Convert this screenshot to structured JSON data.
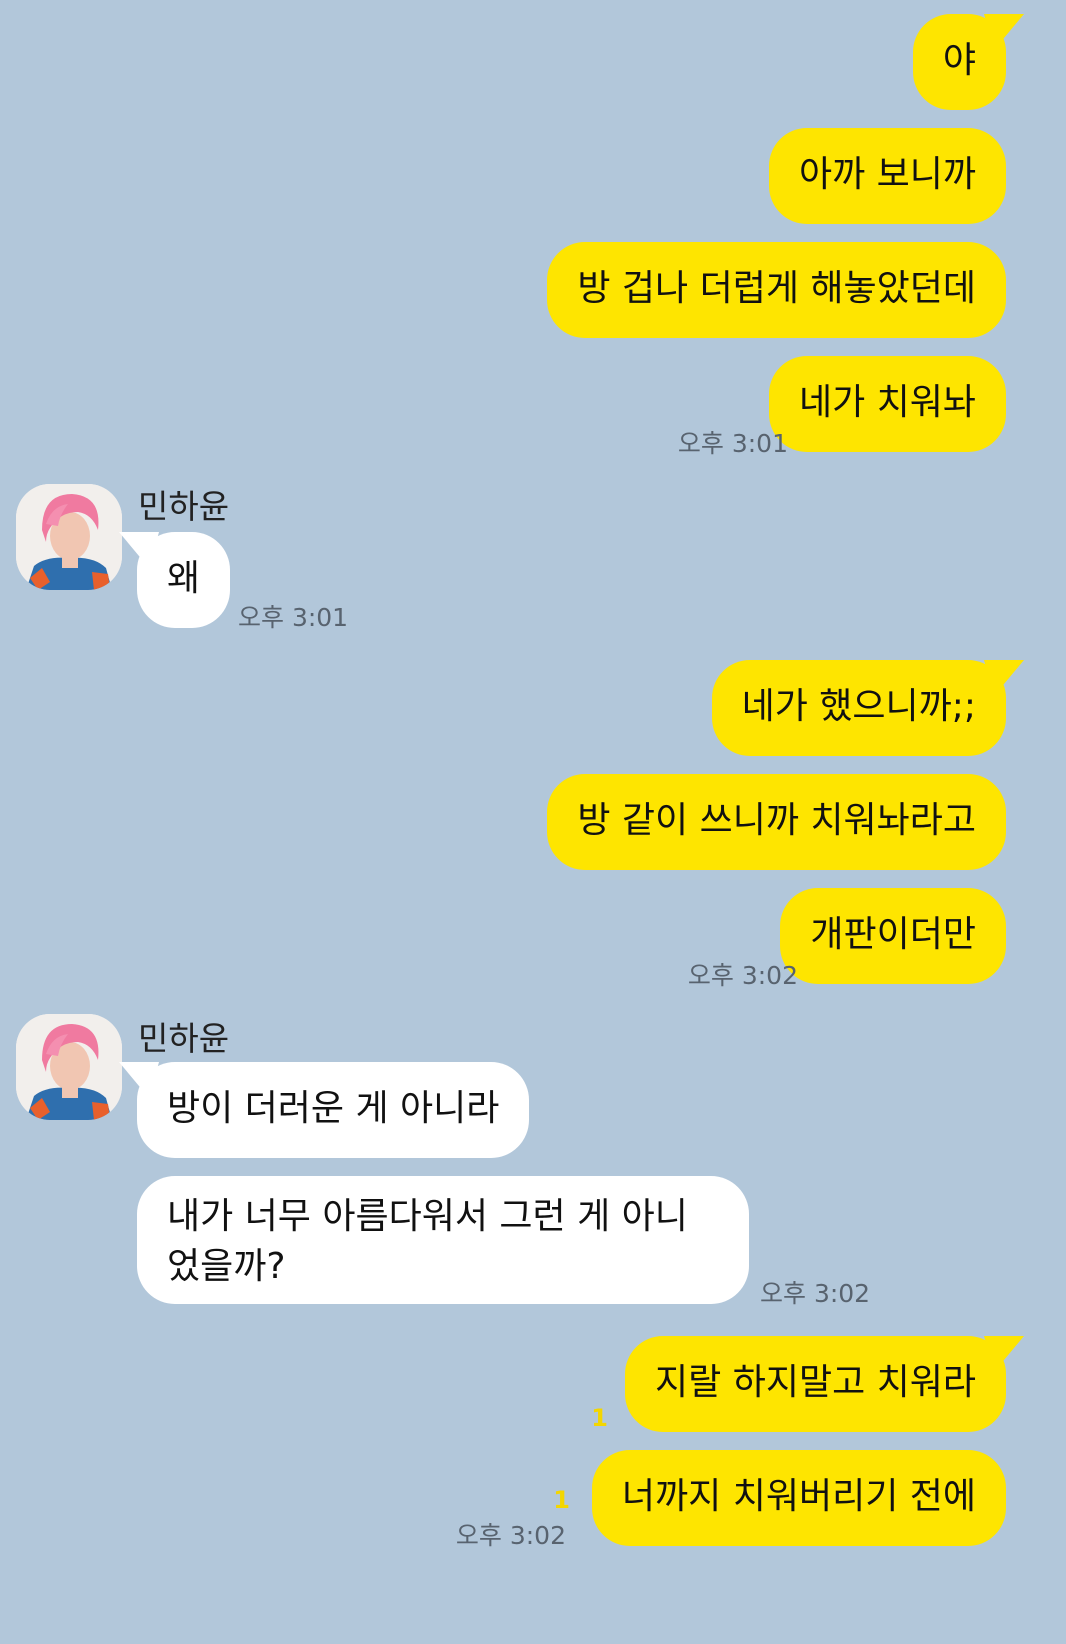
{
  "partner": {
    "name": "민하윤"
  },
  "messages": [
    {
      "sender": "me",
      "text": "야"
    },
    {
      "sender": "me",
      "text": "아까 보니까"
    },
    {
      "sender": "me",
      "text": "방 겁나 더럽게 해놓았던데"
    },
    {
      "sender": "me",
      "text": "네가 치워놔",
      "time": "오후 3:01"
    },
    {
      "sender": "other",
      "text": "왜",
      "time": "오후 3:01"
    },
    {
      "sender": "me",
      "text": "네가 했으니까;;"
    },
    {
      "sender": "me",
      "text": "방 같이 쓰니까 치워놔라고"
    },
    {
      "sender": "me",
      "text": "개판이더만",
      "time": "오후 3:02"
    },
    {
      "sender": "other",
      "text": "방이 더러운 게 아니라"
    },
    {
      "sender": "other",
      "text": "내가 너무 아름다워서 그런 게 아니었을까?",
      "time": "오후 3:02"
    },
    {
      "sender": "me",
      "text": "지랄 하지말고 치워라",
      "unread": "1"
    },
    {
      "sender": "me",
      "text": "너까지 치워버리기 전에",
      "unread": "1",
      "time": "오후 3:02"
    }
  ],
  "colors": {
    "background": "#b2c7da",
    "my_bubble": "#fee500",
    "their_bubble": "#ffffff",
    "unread": "#f3d600"
  },
  "icons": {
    "avatar": "avatar-pink-hair"
  }
}
